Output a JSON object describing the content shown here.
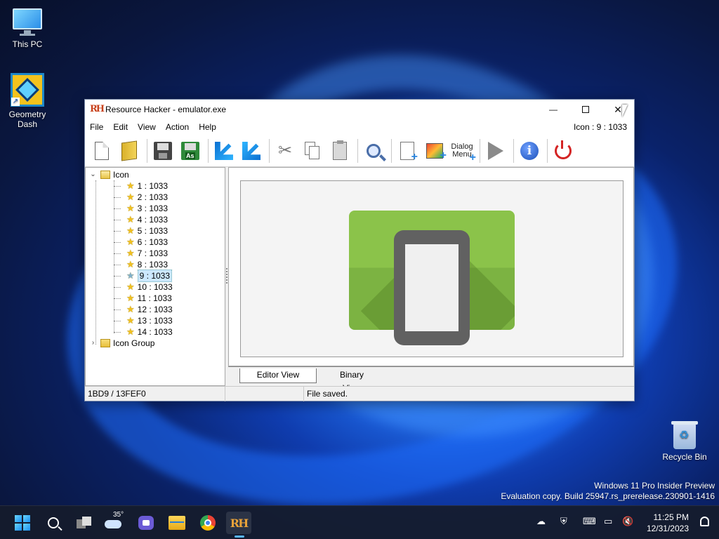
{
  "desktop": {
    "icons": [
      {
        "label": "This PC"
      },
      {
        "label": "Geometry Dash"
      },
      {
        "label": "Recycle Bin"
      }
    ],
    "watermark": {
      "line1": "Windows 11 Pro Insider Preview",
      "line2": "Evaluation copy. Build 25947.rs_prerelease.230901-1416"
    }
  },
  "window": {
    "title": "Resource Hacker - emulator.exe",
    "app_logo": "RH",
    "controls": {
      "minimize": "—",
      "close": "✕"
    },
    "menu": [
      "File",
      "Edit",
      "View",
      "Action",
      "Help"
    ],
    "resource_id": "Icon : 9 : 1033",
    "toolbar": {
      "dialog_label_1": "Dialog",
      "dialog_label_2": "Menu"
    },
    "tree": {
      "root_label": "Icon",
      "items": [
        "1 : 1033",
        "2 : 1033",
        "3 : 1033",
        "4 : 1033",
        "5 : 1033",
        "6 : 1033",
        "7 : 1033",
        "8 : 1033",
        "9 : 1033",
        "10 : 1033",
        "11 : 1033",
        "12 : 1033",
        "13 : 1033",
        "14 : 1033"
      ],
      "selected_index": 8,
      "second_root_label": "Icon Group"
    },
    "tabs": {
      "editor": "Editor View",
      "binary": "Binary View"
    },
    "status": {
      "offset": "1BD9 / 13FEF0",
      "middle": "",
      "message": "File saved."
    }
  },
  "taskbar": {
    "weather_temp": "35°",
    "rh_label": "RH",
    "clock_time": "11:25 PM",
    "clock_date": "12/31/2023"
  },
  "colors": {
    "icon_green": "#8bc34a",
    "phone_gray": "#616161",
    "tree_selection": "#cce8ff",
    "exit_red": "#d42424"
  }
}
